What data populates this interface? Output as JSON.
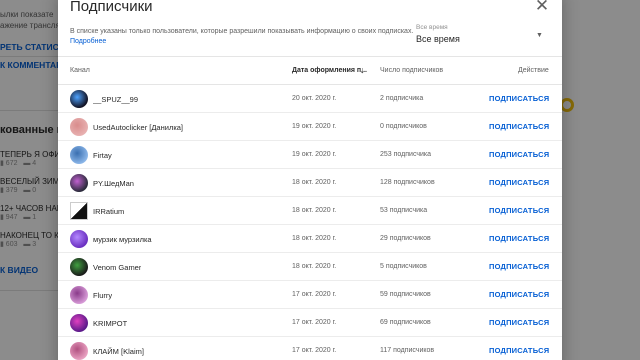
{
  "background": {
    "left_texts": [
      "ылки показате",
      "ажение трансляци",
      "РЕТЬ СТАТИСТИ",
      "К КОММЕНТАР",
      "кованные ви",
      "ТЕПЕРЬ Я ОФИЦ",
      "ВЕСЕЛЫЙ ЗИМНИ",
      "12+ ЧАСОВ НАШЕ",
      "НАКОНЕЦ ТО КРО",
      "К ВИДЕО"
    ],
    "left_stats": [
      {
        "views": "672",
        "comments": "4"
      },
      {
        "views": "379",
        "comments": "0"
      },
      {
        "views": "947",
        "comments": "1"
      },
      {
        "views": "603",
        "comments": "3"
      }
    ],
    "gauge_color": "#f4c20d"
  },
  "dialog": {
    "title": "Подписчики",
    "close_icon": "close-icon",
    "info_text": "В списке указаны только пользователи, которые разрешили показывать информацию о своих подписках.",
    "more_link": "Подробнее",
    "filter": {
      "label": "Все время",
      "value": "Все время"
    },
    "columns": {
      "channel": "Канал",
      "date": "Дата оформления п...",
      "subscribers": "Число подписчиков",
      "action": "Действие"
    },
    "rows": [
      {
        "name": "__SPUZ__99",
        "date": "20 окт. 2020 г.",
        "subs": "2 подписчика",
        "action": "ПОДПИСАТЬСЯ",
        "avatar_color": "#111122",
        "avatar_accent": "#4fa3ff"
      },
      {
        "name": "UsedAutoclicker [Данилка]",
        "date": "19 окт. 2020 г.",
        "subs": "0 подписчиков",
        "action": "ПОДПИСАТЬСЯ",
        "avatar_color": "#e7b0b0",
        "avatar_accent": "#d98c8c"
      },
      {
        "name": "Firtay",
        "date": "19 окт. 2020 г.",
        "subs": "253 подписчика",
        "action": "ПОДПИСАТЬСЯ",
        "avatar_color": "#8bb6e8",
        "avatar_accent": "#3a6fb0"
      },
      {
        "name": "PY.ШедMan",
        "date": "18 окт. 2020 г.",
        "subs": "128 подписчиков",
        "action": "ПОДПИСАТЬСЯ",
        "avatar_color": "#2a2a3a",
        "avatar_accent": "#c060d0"
      },
      {
        "name": "IRRatium",
        "date": "18 окт. 2020 г.",
        "subs": "53 подписчика",
        "action": "ПОДПИСАТЬСЯ",
        "avatar_color": "#ffffff",
        "avatar_accent": "#111111"
      },
      {
        "name": "мурзик мурзилка",
        "date": "18 окт. 2020 г.",
        "subs": "29 подписчиков",
        "action": "ПОДПИСАТЬСЯ",
        "avatar_color": "#6a2fc0",
        "avatar_accent": "#b488ff"
      },
      {
        "name": "Venom Gamer",
        "date": "18 окт. 2020 г.",
        "subs": "5 подписчиков",
        "action": "ПОДПИСАТЬСЯ",
        "avatar_color": "#1a1a1a",
        "avatar_accent": "#40a040"
      },
      {
        "name": "Flurry",
        "date": "17 окт. 2020 г.",
        "subs": "59 подписчиков",
        "action": "ПОДПИСАТЬСЯ",
        "avatar_color": "#d69ad6",
        "avatar_accent": "#8a3a8a"
      },
      {
        "name": "KRIMPOT",
        "date": "17 окт. 2020 г.",
        "subs": "69 подписчиков",
        "action": "ПОДПИСАТЬСЯ",
        "avatar_color": "#5a1a8a",
        "avatar_accent": "#e040c0"
      },
      {
        "name": "КЛАЙМ [Klaim]",
        "date": "17 окт. 2020 г.",
        "subs": "117 подписчиков",
        "action": "ПОДПИСАТЬСЯ",
        "avatar_color": "#e8a0c0",
        "avatar_accent": "#b05080"
      }
    ]
  }
}
